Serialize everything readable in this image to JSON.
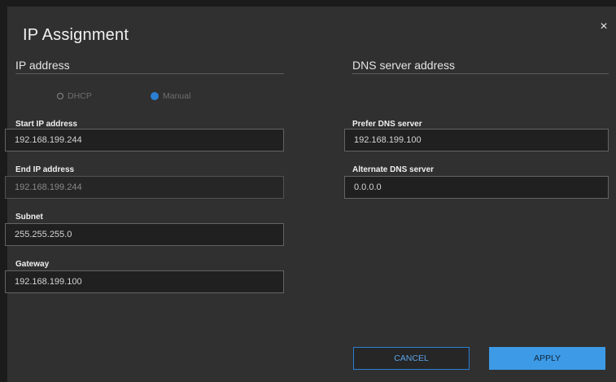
{
  "dialog": {
    "title": "IP Assignment",
    "close_symbol": "×"
  },
  "ip_section": {
    "title": "IP address",
    "mode_options": [
      {
        "label": "DHCP",
        "checked": false
      },
      {
        "label": "Manual",
        "checked": true
      }
    ],
    "fields": [
      {
        "label": "Start IP address",
        "value": "192.168.199.244",
        "enabled": true
      },
      {
        "label": "End IP address",
        "value": "192.168.199.244",
        "enabled": false
      },
      {
        "label": "Subnet",
        "value": "255.255.255.0",
        "enabled": true
      },
      {
        "label": "Gateway",
        "value": "192.168.199.100",
        "enabled": true
      }
    ]
  },
  "dns_section": {
    "title": "DNS server address",
    "fields": [
      {
        "label": "Prefer DNS server",
        "value": "192.168.199.100",
        "enabled": true
      },
      {
        "label": "Alternate DNS server",
        "value": "0.0.0.0",
        "enabled": true
      }
    ]
  },
  "buttons": {
    "cancel_label": "CANCEL",
    "apply_label": "APPLY"
  },
  "colors": {
    "accent": "#2b7fd2",
    "apply_bg": "#3d9ae6",
    "dialog_bg": "#303030"
  }
}
